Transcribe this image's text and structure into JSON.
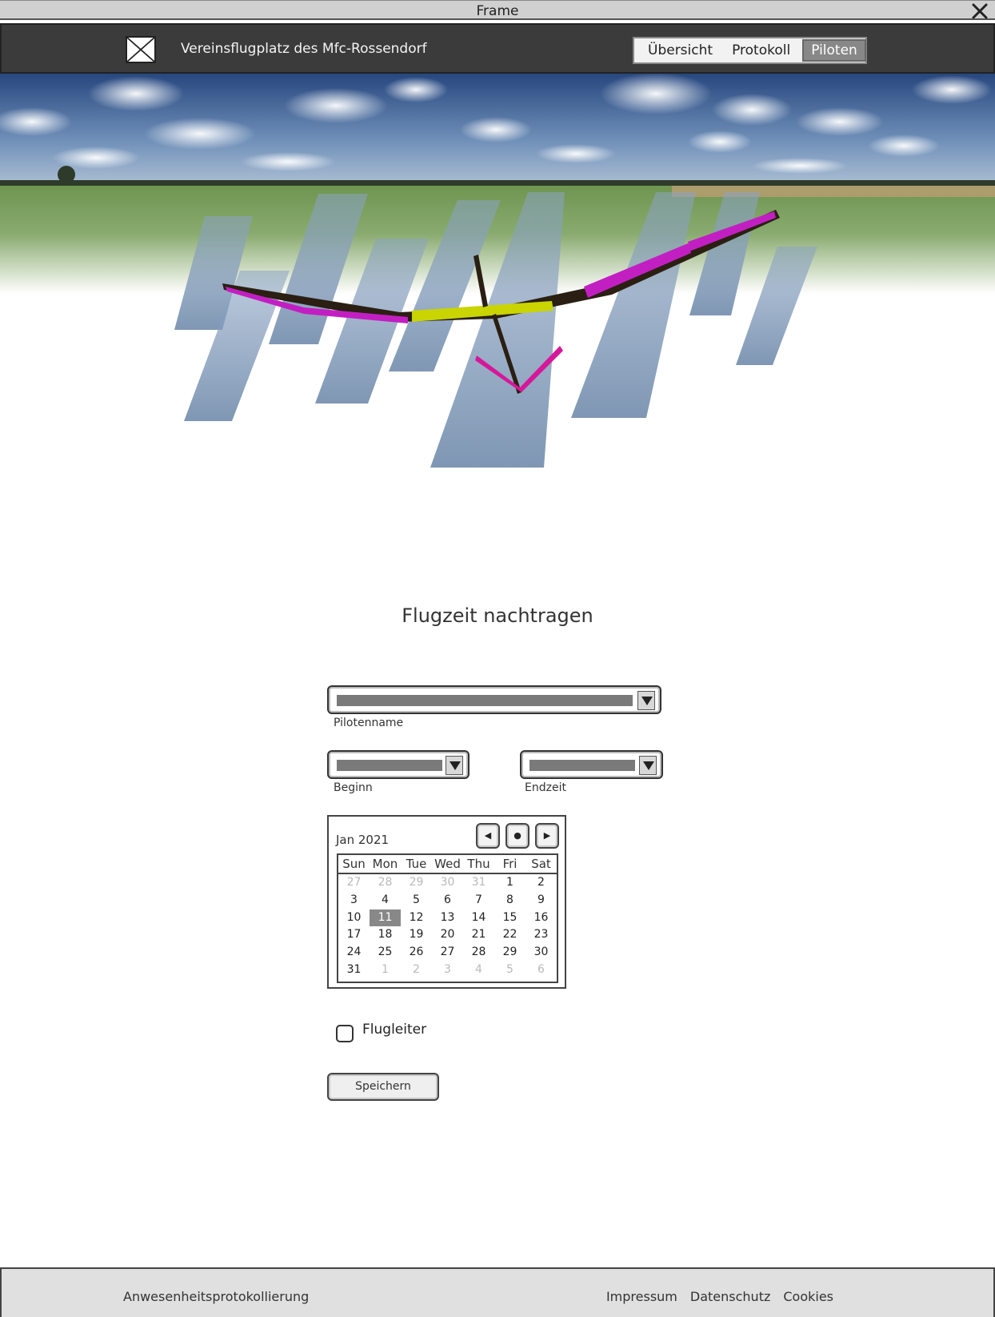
{
  "window": {
    "title": "Frame"
  },
  "header": {
    "site_name": "Vereinsflugplatz des Mfc-Rossendorf",
    "tabs": [
      {
        "label": "Übersicht",
        "active": false
      },
      {
        "label": "Protokoll",
        "active": false
      },
      {
        "label": "Piloten",
        "active": true
      }
    ]
  },
  "main": {
    "title": "Flugzeit nachtragen",
    "pilot_field": {
      "label": "Pilotenname"
    },
    "begin_field": {
      "label": "Beginn"
    },
    "end_field": {
      "label": "Endzeit"
    },
    "calendar": {
      "month": "Jan 2021",
      "weekdays": [
        "Sun",
        "Mon",
        "Tue",
        "Wed",
        "Thu",
        "Fri",
        "Sat"
      ],
      "weeks": [
        [
          "27",
          "28",
          "29",
          "30",
          "31",
          "1",
          "2"
        ],
        [
          "3",
          "4",
          "5",
          "6",
          "7",
          "8",
          "9"
        ],
        [
          "10",
          "11",
          "12",
          "13",
          "14",
          "15",
          "16"
        ],
        [
          "17",
          "18",
          "19",
          "20",
          "21",
          "22",
          "23"
        ],
        [
          "24",
          "25",
          "26",
          "27",
          "28",
          "29",
          "30"
        ],
        [
          "31",
          "1",
          "2",
          "3",
          "4",
          "5",
          "6"
        ]
      ],
      "selected_day": "11",
      "nav": {
        "prev": "◀",
        "today": "●",
        "next": "▶"
      }
    },
    "flugleiter_checkbox": {
      "label": "Flugleiter",
      "checked": false
    },
    "save_label": "Speichern"
  },
  "footer": {
    "brand": "Anwesenheitsprotokollierung",
    "links": [
      "Impressum",
      "Datenschutz",
      "Cookies"
    ]
  },
  "colors": {
    "navbar": "#3b3b3b",
    "accent_selected": "#888888",
    "glider_magenta": "#c21fc2",
    "glider_yellow": "#c9d400"
  }
}
